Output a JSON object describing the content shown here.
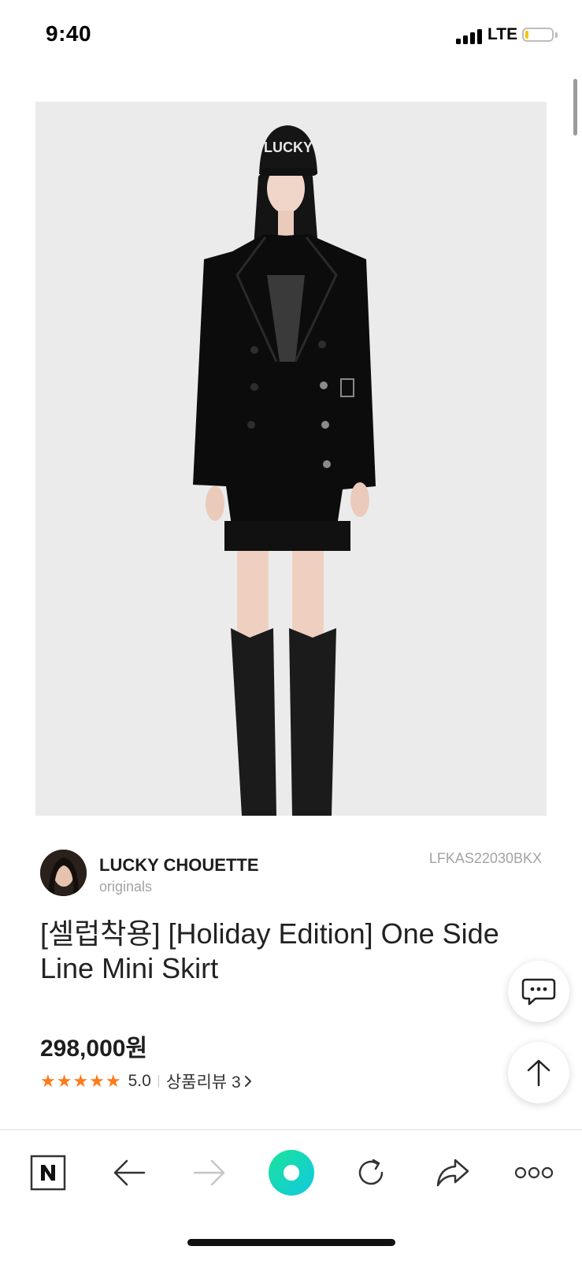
{
  "status_bar": {
    "time": "9:40",
    "network": "LTE",
    "signal_icon": "cellular-signal-icon",
    "battery_icon": "battery-icon",
    "battery_level": 0.1
  },
  "product": {
    "image_icon": "product-photo",
    "brand": {
      "name": "LUCKY CHOUETTE",
      "sub": "originals"
    },
    "code": "LFKAS22030BKX",
    "title": "[셀럽착용] [Holiday Edition] One Side Line Mini Skirt",
    "price": "298,000원",
    "rating": {
      "stars": "★★★★★",
      "value": "5.0",
      "review_label": "상품리뷰 3",
      "star_color": "#ff7a1a"
    }
  },
  "floating_buttons": {
    "chat_icon": "chat-bubble-icon",
    "top_icon": "arrow-up-icon"
  },
  "browser_toolbar": {
    "items": [
      {
        "icon": "naver-n-icon",
        "letter": "N"
      },
      {
        "icon": "back-arrow-icon"
      },
      {
        "icon": "forward-arrow-icon"
      },
      {
        "icon": "green-dot-home-icon",
        "color": "#10dfa0"
      },
      {
        "icon": "refresh-icon"
      },
      {
        "icon": "share-icon"
      },
      {
        "icon": "more-icon"
      }
    ]
  }
}
